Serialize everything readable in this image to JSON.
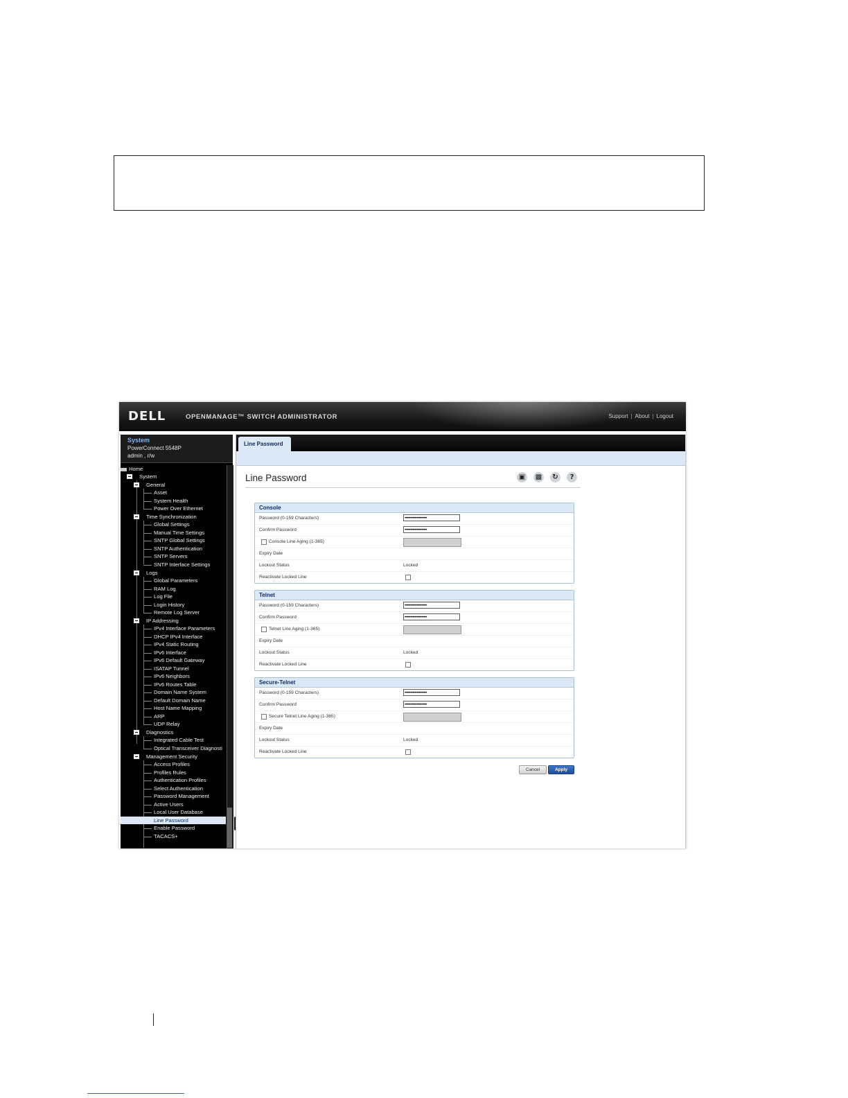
{
  "header": {
    "brand": "DELL",
    "product": "OPENMANAGE™ SWITCH ADMINISTRATOR",
    "links": [
      "Support",
      "About",
      "Logout"
    ]
  },
  "system": {
    "title": "System",
    "model": "PowerConnect 5548P",
    "user": "admin , r/w"
  },
  "tree": {
    "home": "Home",
    "system": "System",
    "general": "General",
    "general_items": [
      "Asset",
      "System Health",
      "Power Over Ethernet"
    ],
    "time_sync": "Time Synchronization",
    "time_items": [
      "Global Settings",
      "Manual Time Settings",
      "SNTP Global Settings",
      "SNTP Authentication",
      "SNTP Servers",
      "SNTP Interface Settings"
    ],
    "logs": "Logs",
    "logs_items": [
      "Global Parameters",
      "RAM Log",
      "Log File",
      "Login History",
      "Remote Log Server"
    ],
    "ip": "IP Addressing",
    "ip_items": [
      "IPv4 Interface Parameters",
      "DHCP IPv4 Interface",
      "IPv4 Static Routing",
      "IPv6 Interface",
      "IPv6 Default Gateway",
      "ISATAP Tunnel",
      "IPv6 Neighbors",
      "IPv6 Routes Table",
      "Domain Name System",
      "Default Domain Name",
      "Host Name Mapping",
      "ARP",
      "UDP Relay"
    ],
    "diag": "Diagnostics",
    "diag_items": [
      "Integrated Cable Test",
      "Optical Transceiver Diagnosti"
    ],
    "mgmt": "Management Security",
    "mgmt_items": [
      "Access Profiles",
      "Profiles Rules",
      "Authentication Profiles",
      "Select Authentication",
      "Password Management",
      "Active Users",
      "Local User Database",
      "Line Password",
      "Enable Password",
      "TACACS+"
    ]
  },
  "tab": "Line Password",
  "page_title": "Line Password",
  "toolbar_icons": [
    "save-icon",
    "print-icon",
    "refresh-icon",
    "help-icon"
  ],
  "sections": [
    {
      "title": "Console",
      "password_label": "Password (0-159 Characters)",
      "password_value": "••••••••••••••••••••",
      "confirm_label": "Confirm Password",
      "confirm_value": "••••••••••••••••••••",
      "aging_label": "Console Line Aging (1-365)",
      "expiry_label": "Expiry Date",
      "lockout_label": "Lockout Status",
      "lockout_value": "Locked",
      "reactivate_label": "Reactivate Locked Line"
    },
    {
      "title": "Telnet",
      "password_label": "Password (0-159 Characters)",
      "password_value": "••••••••••••••••••••",
      "confirm_label": "Confirm Password",
      "confirm_value": "••••••••••••••••••••",
      "aging_label": "Telnet Line Aging (1-365)",
      "expiry_label": "Expiry Date",
      "lockout_label": "Lockout Status",
      "lockout_value": "Locked",
      "reactivate_label": "Reactivate Locked Line"
    },
    {
      "title": "Secure-Telnet",
      "password_label": "Password (0-159 Characters)",
      "password_value": "••••••••••••••••••••",
      "confirm_label": "Confirm Password",
      "confirm_value": "••••••••••••••••••••",
      "aging_label": "Secure Telnet Line Aging (1-365)",
      "expiry_label": "Expiry Date",
      "lockout_label": "Lockout Status",
      "lockout_value": "Locked",
      "reactivate_label": "Reactivate Locked Line"
    }
  ],
  "buttons": {
    "cancel": "Cancel",
    "apply": "Apply"
  },
  "colors": {
    "accent": "#1c4d99",
    "panel": "#dbe8f6",
    "sidebar": "#000000"
  }
}
